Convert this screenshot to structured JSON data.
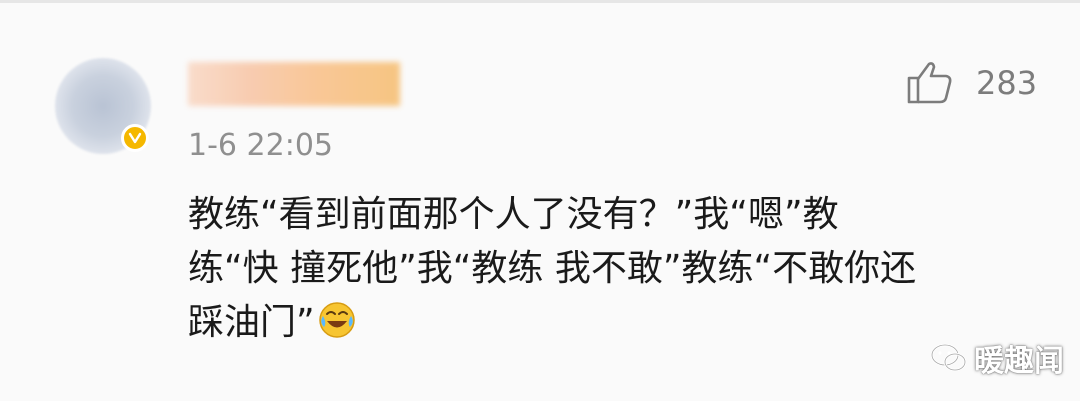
{
  "comment": {
    "author": {
      "avatar_icon": "blurred-avatar",
      "verified_badge_icon": "verified-v-icon",
      "verified_badge_color": "#f5b800",
      "name_censor_colors": [
        "#f9d9c6",
        "#f6c075"
      ]
    },
    "timestamp": "1-6 22:05",
    "likes": {
      "icon": "thumbs-up-icon",
      "count": "283"
    },
    "text_lines": [
      "教练“看到前面那个人了没有？”我“嗯”教",
      "练“快 撞死他”我“教练 我不敢”教练“不敢你还",
      "踩油门”"
    ],
    "trailing_emoji": "laughing-crying-emoji-icon"
  },
  "watermark": {
    "logo_icon": "wechat-style-icon",
    "text": "暖趣闻"
  },
  "colors": {
    "background": "#fafafa",
    "text": "#1a1a1a",
    "meta": "#8f8f8f"
  }
}
